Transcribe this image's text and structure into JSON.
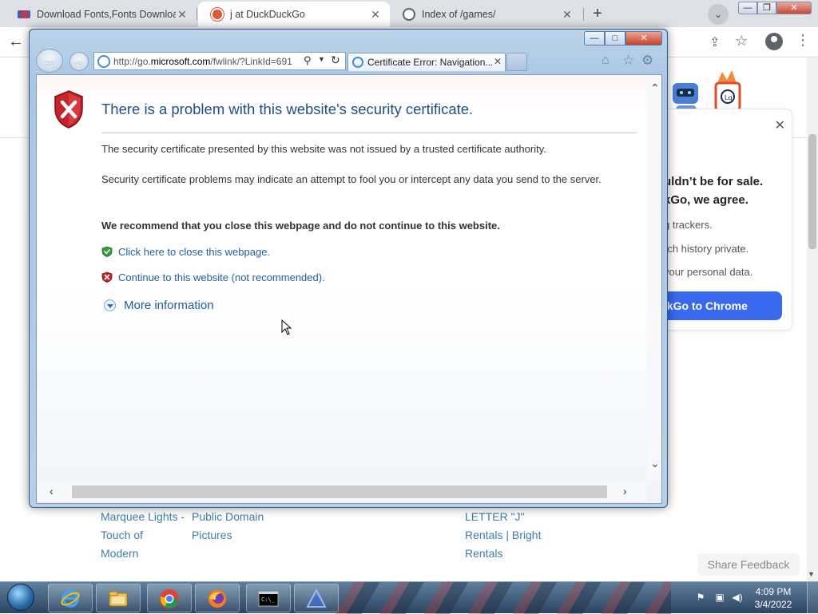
{
  "chrome": {
    "tabs": [
      {
        "label": "Download Fonts,Fonts Download",
        "close": "✕"
      },
      {
        "label": "j at DuckDuckGo",
        "close": "✕"
      },
      {
        "label": "Index of /games/",
        "close": "✕"
      }
    ],
    "new_tab": "+",
    "tab_search": "⌄",
    "window_controls": {
      "minimize": "—",
      "maximize": "❐",
      "close": "✕"
    },
    "back": "←",
    "share": "⇪",
    "bookmark": "☆",
    "menu": "⋮"
  },
  "ddg_card": {
    "close": "✕",
    "headline_line1": "uldn’t be for sale.",
    "headline_line2": "kGo, we agree.",
    "bullets": [
      "g trackers.",
      "rch history private.",
      "your personal data."
    ],
    "cta": "ckGo to Chrome",
    "accent_color": "#3969ef"
  },
  "results": {
    "col1": [
      "Marquee Lights -",
      "Touch of",
      "Modern"
    ],
    "col2": [
      "Public Domain",
      "Pictures"
    ],
    "col3": [
      "LETTER \"J\"",
      "Rentals | Bright",
      "Rentals"
    ]
  },
  "share_feedback": "Share Feedback",
  "ie": {
    "window_controls": {
      "minimize": "—",
      "maximize": "□",
      "close": "✕"
    },
    "back": "←",
    "forward": "→",
    "address_prefix": "http://go.",
    "address_domain": "microsoft.com",
    "address_suffix": "/fwlink/?LinkId=691",
    "search_icon": "⚲",
    "dropdown_icon": "▼",
    "refresh_icon": "↻",
    "tab_label": "Certificate Error: Navigation...",
    "tab_close": "✕",
    "home_icon": "⌂",
    "favorites_icon": "☆",
    "tools_icon": "⚙"
  },
  "cert_page": {
    "title": "There is a problem with this website's security certificate.",
    "para1": "The security certificate presented by this website was not issued by a trusted certificate authority.",
    "para2": "Security certificate problems may indicate an attempt to fool you or intercept any data you send to the server.",
    "recommend": "We recommend that you close this webpage and do not continue to this website.",
    "close_link": "Click here to close this webpage.",
    "continue_link": "Continue to this website (not recommended).",
    "more_info": "More information"
  },
  "scroll": {
    "up": "⌃",
    "down": "⌄",
    "left": "‹",
    "right": "›"
  },
  "taskbar": {
    "clock_time": "4:09 PM",
    "clock_date": "3/4/2022"
  }
}
